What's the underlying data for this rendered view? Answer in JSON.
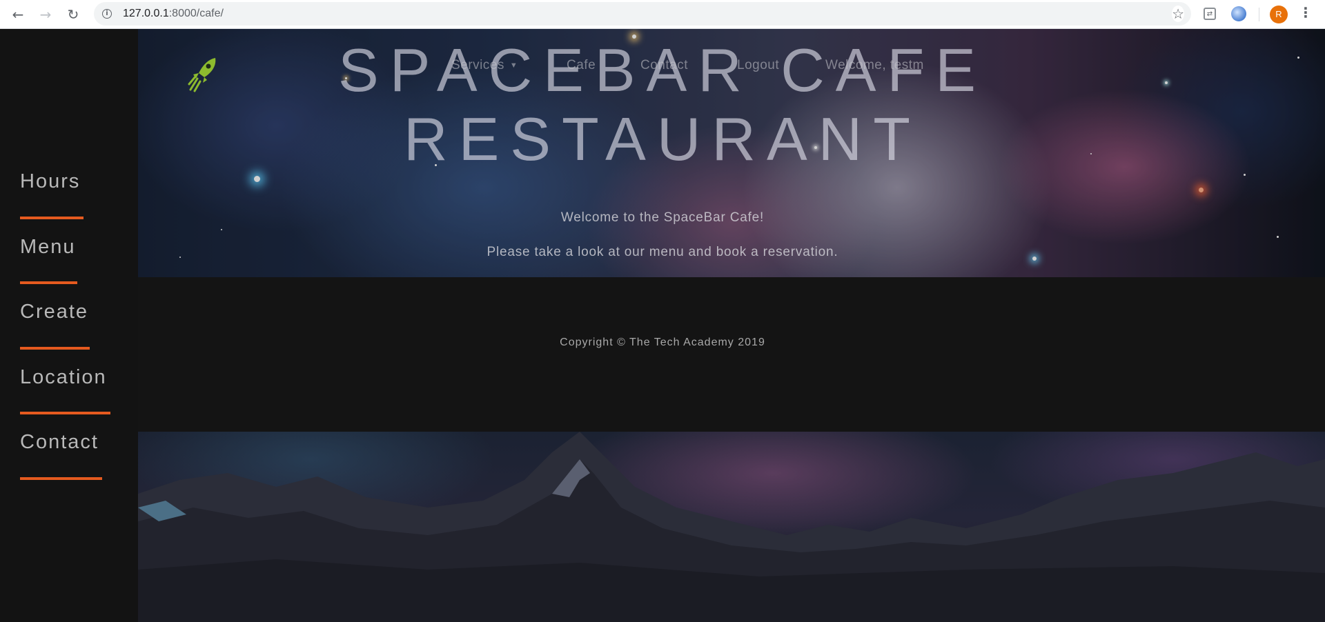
{
  "browser": {
    "url_host": "127.0.0.1",
    "url_rest": ":8000/cafe/",
    "profile_initial": "R"
  },
  "sidebar": {
    "items": [
      {
        "label": "Hours"
      },
      {
        "label": "Menu"
      },
      {
        "label": "Create"
      },
      {
        "label": "Location"
      },
      {
        "label": "Contact"
      }
    ],
    "accent_color": "#e55a1f"
  },
  "hero": {
    "title_line1": "SPACEBAR CAFE",
    "title_line2": "RESTAURANT",
    "welcome": "Welcome to the SpaceBar Cafe!",
    "tagline": "Please take a look at our menu and book a reservation."
  },
  "topnav": {
    "services": "Services",
    "cafe": "Cafe",
    "contact": "Contact",
    "logout": "Logout",
    "welcome_user": "Welcome, testm"
  },
  "footer": {
    "copyright": "Copyright © The Tech Academy 2019"
  },
  "icons": {
    "logo": "rocket-icon",
    "back": "arrow-left-icon",
    "forward": "arrow-right-icon",
    "reload": "reload-icon",
    "bookmark": "star-icon",
    "menu": "kebab-menu-icon"
  }
}
